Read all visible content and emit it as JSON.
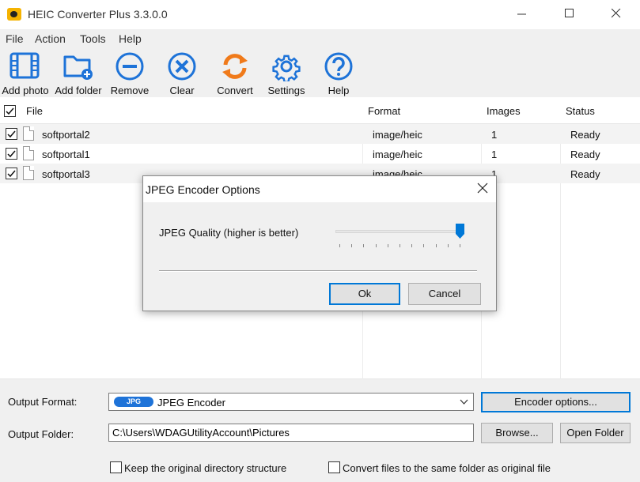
{
  "window": {
    "title": "HEIC Converter Plus 3.3.0.0"
  },
  "menu": [
    "File",
    "Action",
    "Tools",
    "Help"
  ],
  "toolbar": {
    "add_photo": "Add photo",
    "add_folder": "Add folder",
    "remove": "Remove",
    "clear": "Clear",
    "convert": "Convert",
    "settings": "Settings",
    "help": "Help"
  },
  "table": {
    "headers": {
      "file": "File",
      "format": "Format",
      "images": "Images",
      "status": "Status"
    },
    "rows": [
      {
        "checked": true,
        "file": "softportal2",
        "format": "image/heic",
        "images": "1",
        "status": "Ready"
      },
      {
        "checked": true,
        "file": "softportal1",
        "format": "image/heic",
        "images": "1",
        "status": "Ready"
      },
      {
        "checked": true,
        "file": "softportal3",
        "format": "image/heic",
        "images": "1",
        "status": "Ready"
      }
    ]
  },
  "bottom": {
    "output_format_label": "Output Format:",
    "format_badge": "JPG",
    "format_value": "JPEG Encoder",
    "encoder_options": "Encoder options...",
    "output_folder_label": "Output Folder:",
    "output_folder_value": "C:\\Users\\WDAGUtilityAccount\\Pictures",
    "browse": "Browse...",
    "open_folder": "Open Folder",
    "keep_structure": "Keep the original directory structure",
    "same_folder": "Convert files to the same folder as original file"
  },
  "dialog": {
    "title": "JPEG Encoder Options",
    "quality_label": "JPEG Quality (higher is better)",
    "quality_level": 1.0,
    "ok": "Ok",
    "cancel": "Cancel"
  },
  "colors": {
    "accent": "#1e73d8",
    "convert": "#f07a1a",
    "chrome": "#f0f0f0"
  }
}
